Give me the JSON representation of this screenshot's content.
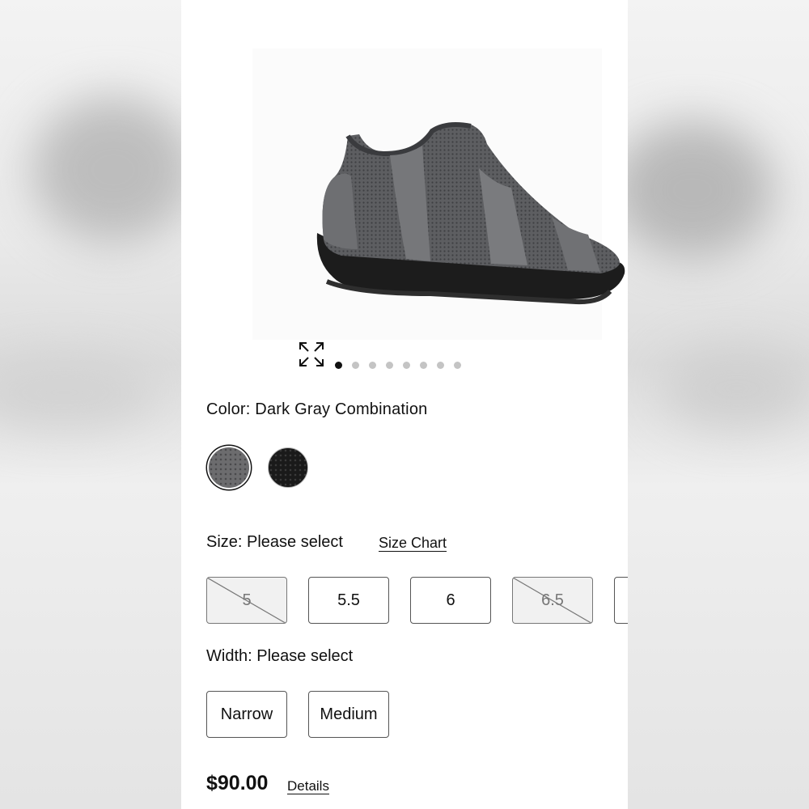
{
  "product": {
    "image_alt": "Dark gray knit slip-on shoe",
    "gallery": {
      "total": 8,
      "active_index": 0
    },
    "color": {
      "label": "Color: Dark Gray Combination",
      "swatches": [
        "dark-gray",
        "black"
      ],
      "selected": "dark-gray"
    },
    "size": {
      "label": "Size: Please select",
      "chart_link": "Size Chart",
      "options": [
        {
          "label": "5",
          "available": false
        },
        {
          "label": "5.5",
          "available": true
        },
        {
          "label": "6",
          "available": true
        },
        {
          "label": "6.5",
          "available": false
        }
      ]
    },
    "width": {
      "label": "Width: Please select",
      "options": [
        "Narrow",
        "Medium"
      ]
    },
    "price": "$90.00",
    "details_link": "Details"
  },
  "colors": {
    "backdrop": "#ececec",
    "panel": "#ffffff",
    "border": "#555555",
    "active_dot": "#111111",
    "inactive_dot": "#c4c4c4"
  }
}
